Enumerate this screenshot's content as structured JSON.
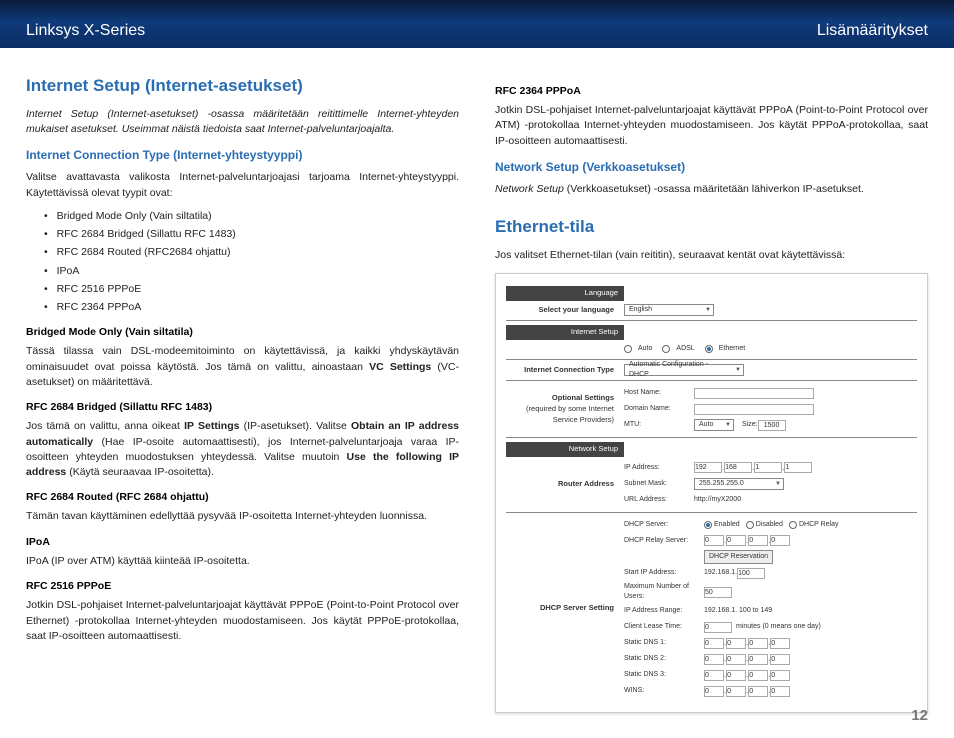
{
  "header": {
    "left": "Linksys X-Series",
    "right": "Lisämääritykset"
  },
  "pagenum": "12",
  "left": {
    "h2": "Internet Setup (Internet-asetukset)",
    "intro": "Internet Setup (Internet-asetukset) -osassa määritetään reitittimelle Internet-yhteyden mukaiset asetukset. Useimmat näistä tiedoista saat Internet-palveluntarjoajalta.",
    "h3": "Internet Connection Type (Internet-yhteystyyppi)",
    "p1": "Valitse avattavasta valikosta Internet-palveluntarjoajasi tarjoama Internet-yhteystyyppi. Käytettävissä olevat tyypit ovat:",
    "list": [
      "Bridged Mode Only (Vain siltatila)",
      "RFC 2684 Bridged (Sillattu RFC 1483)",
      "RFC 2684 Routed (RFC2684 ohjattu)",
      "IPoA",
      "RFC 2516 PPPoE",
      "RFC 2364 PPPoA"
    ],
    "bm_h": "Bridged Mode Only (Vain siltatila)",
    "bm_p": "Tässä tilassa vain DSL-modeemitoiminto on käytettävissä, ja kaikki yhdyskäytävän ominaisuudet ovat poissa käytöstä. Jos tämä on valittu, ainoastaan VC Settings (VC-asetukset) on määritettävä.",
    "rb_h": "RFC 2684 Bridged (Sillattu RFC 1483)",
    "rb_p": "Jos tämä on valittu, anna oikeat IP Settings (IP-asetukset). Valitse Obtain an IP address automatically (Hae IP-osoite automaattisesti), jos Internet-palveluntarjoaja varaa IP-osoitteen yhteyden muodostuksen yhteydessä. Valitse muutoin Use the following IP address (Käytä seuraavaa IP-osoitetta).",
    "rr_h": "RFC 2684 Routed (RFC 2684 ohjattu)",
    "rr_p": "Tämän tavan käyttäminen edellyttää pysyvää IP-osoitetta Internet-yhteyden luonnissa.",
    "ip_h": "IPoA",
    "ip_p": "IPoA (IP over ATM) käyttää kiinteää IP-osoitetta.",
    "pe_h": "RFC 2516 PPPoE",
    "pe_p": "Jotkin DSL-pohjaiset Internet-palveluntarjoajat käyttävät PPPoE (Point-to-Point Protocol over Ethernet) -protokollaa Internet-yhteyden muodostamiseen. Jos käytät PPPoE-protokollaa, saat IP-osoitteen automaattisesti."
  },
  "right": {
    "pa_h": "RFC 2364 PPPoA",
    "pa_p": "Jotkin DSL-pohjaiset Internet-palveluntarjoajat käyttävät PPPoA (Point-to-Point Protocol over ATM) -protokollaa Internet-yhteyden muodostamiseen. Jos käytät PPPoA-protokollaa, saat IP-osoitteen automaattisesti.",
    "ns_h": "Network Setup (Verkkoasetukset)",
    "ns_p": "Network Setup (Verkkoasetukset) -osassa määritetään lähiverkon IP-asetukset.",
    "eth_h": "Ethernet-tila",
    "eth_p": "Jos valitset Ethernet-tilan (vain reititin), seuraavat kentät ovat käytettävissä:"
  },
  "shot": {
    "lang_hdr": "Language",
    "lang_lbl": "Select your language",
    "lang_val": "English",
    "is_hdr": "Internet Setup",
    "mode_auto": "Auto",
    "mode_adsl": "ADSL",
    "mode_eth": "Ethernet",
    "ict_lbl": "Internet Connection Type",
    "ict_val": "Automatic Configuration - DHCP",
    "opt_lbl1": "Optional Settings",
    "opt_lbl2": "(required by some Internet",
    "opt_lbl3": "Service Providers)",
    "host": "Host Name:",
    "domain": "Domain Name:",
    "mtu": "MTU:",
    "mtu_val": "Auto",
    "size": "Size:",
    "size_val": "1500",
    "ns_hdr": "Network Setup",
    "ra_lbl": "Router Address",
    "ip_lbl": "IP Address:",
    "ip_vals": [
      "192",
      "168",
      "1",
      "1"
    ],
    "sm_lbl": "Subnet Mask:",
    "sm_val": "255.255.255.0",
    "url_lbl": "URL Address:",
    "url_val": "http://myX2000",
    "dhcp_set": "DHCP Server Setting",
    "dhcp_srv": "DHCP Server:",
    "enabled": "Enabled",
    "disabled": "Disabled",
    "relay": "DHCP Relay",
    "relay_srv": "DHCP Relay Server:",
    "relay_vals": [
      "0",
      "0",
      "0",
      "0"
    ],
    "dhcp_res": "DHCP Reservation",
    "start_ip": "Start IP Address:",
    "start_ip_v1": "192.168.1.",
    "start_ip_v2": "100",
    "max_users": "Maximum Number of Users:",
    "max_users_v": "50",
    "range_lbl": "IP Address Range:",
    "range_v": "192.168.1. 100 to 149",
    "lease_lbl": "Client Lease Time:",
    "lease_v": "0",
    "lease_txt": "minutes (0 means one day)",
    "dns1": "Static DNS 1:",
    "dns2": "Static DNS 2:",
    "dns3": "Static DNS 3:",
    "dns_zeros": [
      "0",
      "0",
      "0",
      "0"
    ],
    "wins": "WINS:"
  }
}
